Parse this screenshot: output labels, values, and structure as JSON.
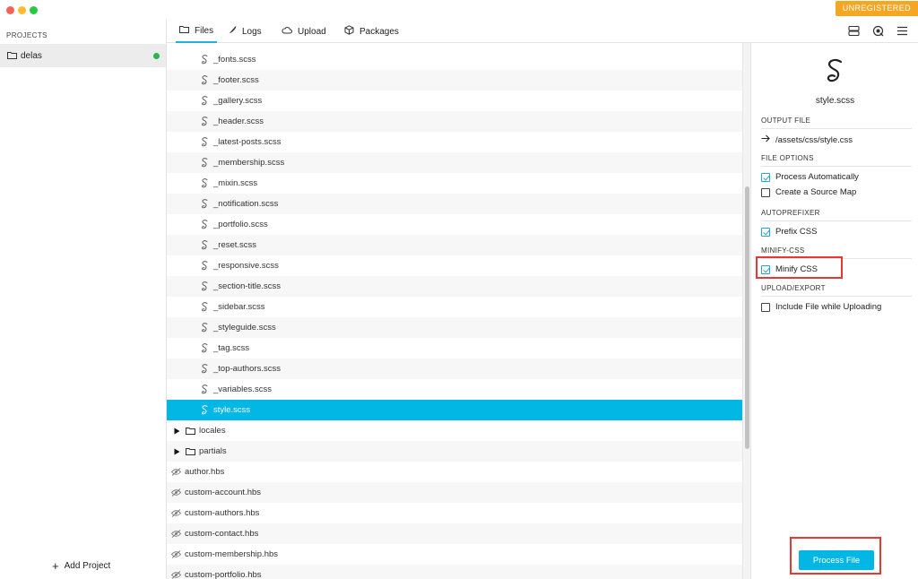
{
  "window": {
    "badge": "UNREGISTERED"
  },
  "sidebar": {
    "heading": "PROJECTS",
    "projects": [
      {
        "name": "delas",
        "status_color": "#2db54a"
      }
    ],
    "add_project": "Add Project"
  },
  "tabs": [
    {
      "label": "Files",
      "icon": "folder-icon",
      "active": true
    },
    {
      "label": "Logs",
      "icon": "feather-icon",
      "active": false
    },
    {
      "label": "Upload",
      "icon": "cloud-icon",
      "active": false
    },
    {
      "label": "Packages",
      "icon": "package-icon",
      "active": false
    }
  ],
  "top_icons": [
    "server-icon",
    "refresh-target-icon",
    "menu-icon"
  ],
  "files": [
    {
      "name": "_fonts.scss",
      "kind": "sass"
    },
    {
      "name": "_footer.scss",
      "kind": "sass"
    },
    {
      "name": "_gallery.scss",
      "kind": "sass"
    },
    {
      "name": "_header.scss",
      "kind": "sass"
    },
    {
      "name": "_latest-posts.scss",
      "kind": "sass"
    },
    {
      "name": "_membership.scss",
      "kind": "sass"
    },
    {
      "name": "_mixin.scss",
      "kind": "sass"
    },
    {
      "name": "_notification.scss",
      "kind": "sass"
    },
    {
      "name": "_portfolio.scss",
      "kind": "sass"
    },
    {
      "name": "_reset.scss",
      "kind": "sass"
    },
    {
      "name": "_responsive.scss",
      "kind": "sass"
    },
    {
      "name": "_section-title.scss",
      "kind": "sass"
    },
    {
      "name": "_sidebar.scss",
      "kind": "sass"
    },
    {
      "name": "_styleguide.scss",
      "kind": "sass"
    },
    {
      "name": "_tag.scss",
      "kind": "sass"
    },
    {
      "name": "_top-authors.scss",
      "kind": "sass"
    },
    {
      "name": "_variables.scss",
      "kind": "sass"
    },
    {
      "name": "style.scss",
      "kind": "sass",
      "selected": true
    },
    {
      "name": "locales",
      "kind": "folder"
    },
    {
      "name": "partials",
      "kind": "folder"
    },
    {
      "name": "author.hbs",
      "kind": "hidden"
    },
    {
      "name": "custom-account.hbs",
      "kind": "hidden"
    },
    {
      "name": "custom-authors.hbs",
      "kind": "hidden"
    },
    {
      "name": "custom-contact.hbs",
      "kind": "hidden"
    },
    {
      "name": "custom-membership.hbs",
      "kind": "hidden"
    },
    {
      "name": "custom-portfolio.hbs",
      "kind": "hidden"
    }
  ],
  "panel": {
    "filename": "style.scss",
    "output_file_title": "OUTPUT FILE",
    "output_path": "/assets/css/style.css",
    "file_options_title": "FILE OPTIONS",
    "process_automatically": {
      "label": "Process Automatically",
      "checked": true
    },
    "source_map": {
      "label": "Create a Source Map",
      "checked": false
    },
    "autoprefixer_title": "AUTOPREFIXER",
    "prefix_css": {
      "label": "Prefix CSS",
      "checked": true
    },
    "minify_title": "MINIFY-CSS",
    "minify_css": {
      "label": "Minify CSS",
      "checked": true
    },
    "upload_title": "UPLOAD/EXPORT",
    "include_upload": {
      "label": "Include File while Uploading",
      "checked": false
    },
    "process_button": "Process File"
  },
  "colors": {
    "accent": "#03b7e5",
    "badge": "#f5a623",
    "highlight": "#e53935"
  }
}
